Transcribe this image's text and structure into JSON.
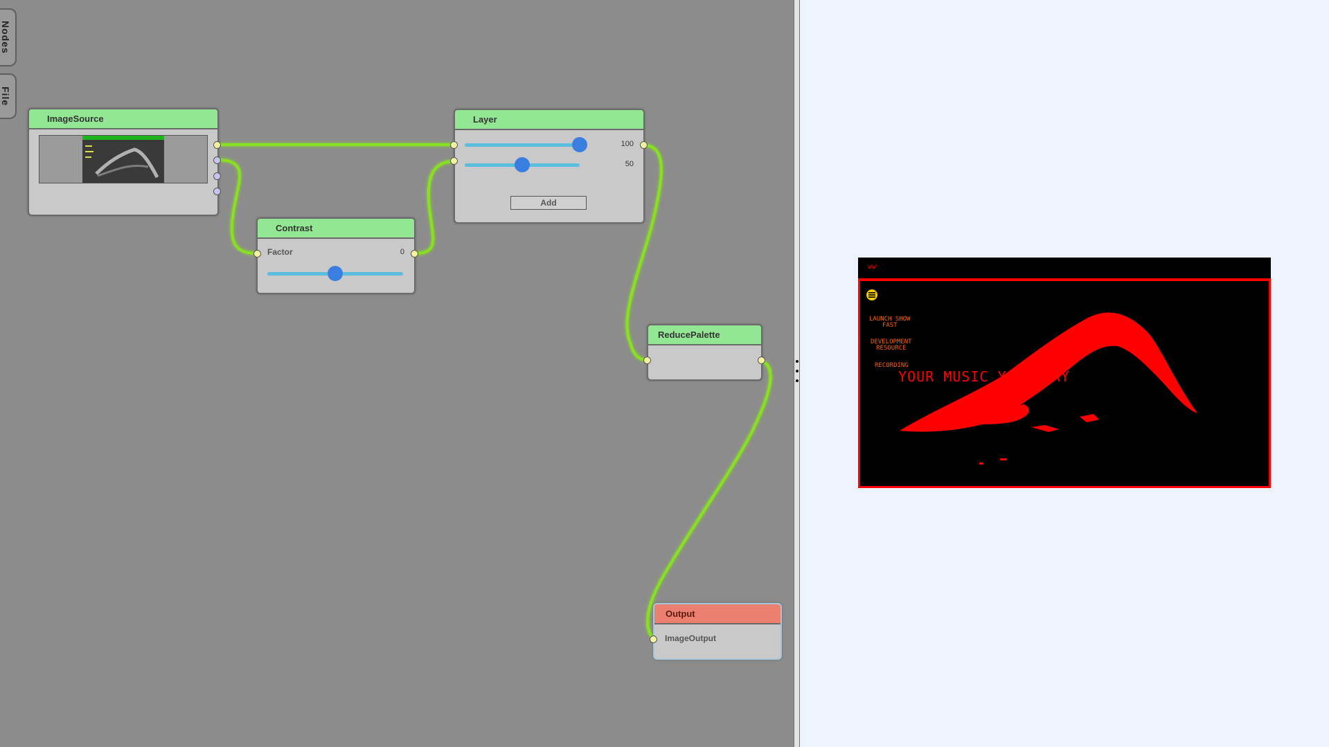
{
  "tabs": {
    "nodes": "Nodes",
    "file": "File"
  },
  "nodes": {
    "image_source": {
      "title": "ImageSource"
    },
    "contrast": {
      "title": "Contrast",
      "factor_label": "Factor",
      "factor_value": "0",
      "factor_level": 0.5
    },
    "layer": {
      "title": "Layer",
      "slider1_value": "100",
      "slider1_level": 1.0,
      "slider2_value": "50",
      "slider2_level": 0.5,
      "add_label": "Add"
    },
    "reduce_palette": {
      "title": "ReducePalette"
    },
    "output": {
      "title": "Output",
      "port_label": "ImageOutput"
    }
  },
  "preview": {
    "top_mark": "ww",
    "menu_items": [
      "LAUNCH SHOW\nFAST",
      "DEVELOPMENT\nRESOURCE",
      "RECORDING"
    ],
    "headline": "YOUR MUSIC YOUR WAY"
  },
  "colors": {
    "canvas": "#8c8c8c",
    "node_header": "#93e693",
    "output_header": "#ec8070",
    "wire": "#88e020",
    "preview_bg": "#eef4fd",
    "filter_red": "#ff0000"
  }
}
